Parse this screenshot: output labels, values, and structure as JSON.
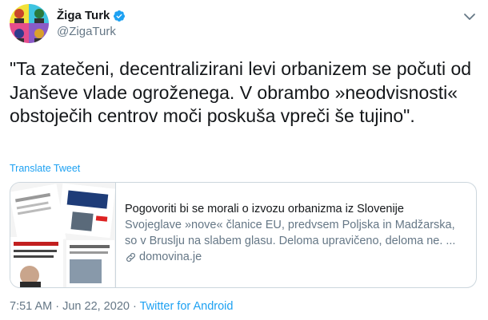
{
  "author": {
    "name": "Žiga Turk",
    "handle": "@ZigaTurk",
    "verified": true,
    "avatar_icon": "pop-art-portrait-avatar"
  },
  "tweet": {
    "text": "\"Ta zatečeni, decentralizirani levi orbanizem se počuti od Janševe vlade ogroženega. V obrambo »neodvisnosti« obstoječih centrov moči poskuša vpreči še tujino\".",
    "translate_label": "Translate Tweet"
  },
  "card": {
    "title": "Pogovoriti bi se morali o izvozu orbanizma iz Slovenije",
    "description": "Svojeglave »nove« članice EU, predvsem Poljska in Madžarska, so v Bruslju na slabem glasu. Deloma upravičeno, deloma ne. ...",
    "domain": "domovina.je",
    "image_icon": "newspaper-collage-thumbnail"
  },
  "meta": {
    "time": "7:51 AM",
    "separator1": " · ",
    "date": "Jun 22, 2020",
    "separator2": " · ",
    "source": "Twitter for Android"
  },
  "colors": {
    "link": "#1da1f2",
    "secondary_text": "#657786",
    "border": "#ccd6dd"
  }
}
